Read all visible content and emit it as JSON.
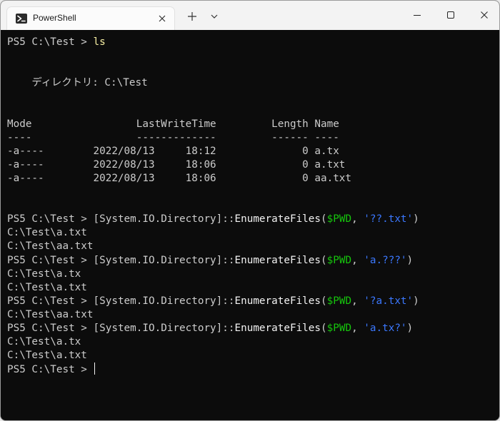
{
  "window": {
    "tab_title": "PowerShell",
    "icons": {
      "app": "powershell-icon",
      "tab_close": "close-icon",
      "new_tab": "plus-icon",
      "dropdown": "chevron-down-icon",
      "minimize": "minimize-icon",
      "maximize": "maximize-icon",
      "close": "close-icon"
    }
  },
  "colors": {
    "background": "#0c0c0c",
    "text": "#cccccc",
    "command": "#f9f1a5",
    "method": "#f2f2f2",
    "variable": "#16c60c",
    "string": "#3b78ff"
  },
  "terminal": {
    "lines": [
      [
        {
          "t": "PS5 C:\\Test > "
        },
        {
          "t": "ls",
          "c": "yellow"
        }
      ],
      [],
      [],
      [
        {
          "t": "    ディレクトリ: C:\\Test"
        }
      ],
      [],
      [],
      [
        {
          "t": "Mode                 LastWriteTime         Length Name"
        }
      ],
      [
        {
          "t": "----                 -------------         ------ ----"
        }
      ],
      [
        {
          "t": "-a----        2022/08/13     18:12              0 a.tx"
        }
      ],
      [
        {
          "t": "-a----        2022/08/13     18:06              0 a.txt"
        }
      ],
      [
        {
          "t": "-a----        2022/08/13     18:06              0 aa.txt"
        }
      ],
      [],
      [],
      [
        {
          "t": "PS5 C:\\Test > "
        },
        {
          "t": "[System.IO.Directory]::"
        },
        {
          "t": "EnumerateFiles",
          "c": "white"
        },
        {
          "t": "("
        },
        {
          "t": "$PWD",
          "c": "green"
        },
        {
          "t": ", "
        },
        {
          "t": "'??.txt'",
          "c": "blue"
        },
        {
          "t": ")"
        }
      ],
      [
        {
          "t": "C:\\Test\\a.txt"
        }
      ],
      [
        {
          "t": "C:\\Test\\aa.txt"
        }
      ],
      [
        {
          "t": "PS5 C:\\Test > "
        },
        {
          "t": "[System.IO.Directory]::"
        },
        {
          "t": "EnumerateFiles",
          "c": "white"
        },
        {
          "t": "("
        },
        {
          "t": "$PWD",
          "c": "green"
        },
        {
          "t": ", "
        },
        {
          "t": "'a.???'",
          "c": "blue"
        },
        {
          "t": ")"
        }
      ],
      [
        {
          "t": "C:\\Test\\a.tx"
        }
      ],
      [
        {
          "t": "C:\\Test\\a.txt"
        }
      ],
      [
        {
          "t": "PS5 C:\\Test > "
        },
        {
          "t": "[System.IO.Directory]::"
        },
        {
          "t": "EnumerateFiles",
          "c": "white"
        },
        {
          "t": "("
        },
        {
          "t": "$PWD",
          "c": "green"
        },
        {
          "t": ", "
        },
        {
          "t": "'?a.txt'",
          "c": "blue"
        },
        {
          "t": ")"
        }
      ],
      [
        {
          "t": "C:\\Test\\aa.txt"
        }
      ],
      [
        {
          "t": "PS5 C:\\Test > "
        },
        {
          "t": "[System.IO.Directory]::"
        },
        {
          "t": "EnumerateFiles",
          "c": "white"
        },
        {
          "t": "("
        },
        {
          "t": "$PWD",
          "c": "green"
        },
        {
          "t": ", "
        },
        {
          "t": "'a.tx?'",
          "c": "blue"
        },
        {
          "t": ")"
        }
      ],
      [
        {
          "t": "C:\\Test\\a.tx"
        }
      ],
      [
        {
          "t": "C:\\Test\\a.txt"
        }
      ],
      [
        {
          "t": "PS5 C:\\Test > "
        },
        {
          "cursor": true
        }
      ]
    ]
  }
}
